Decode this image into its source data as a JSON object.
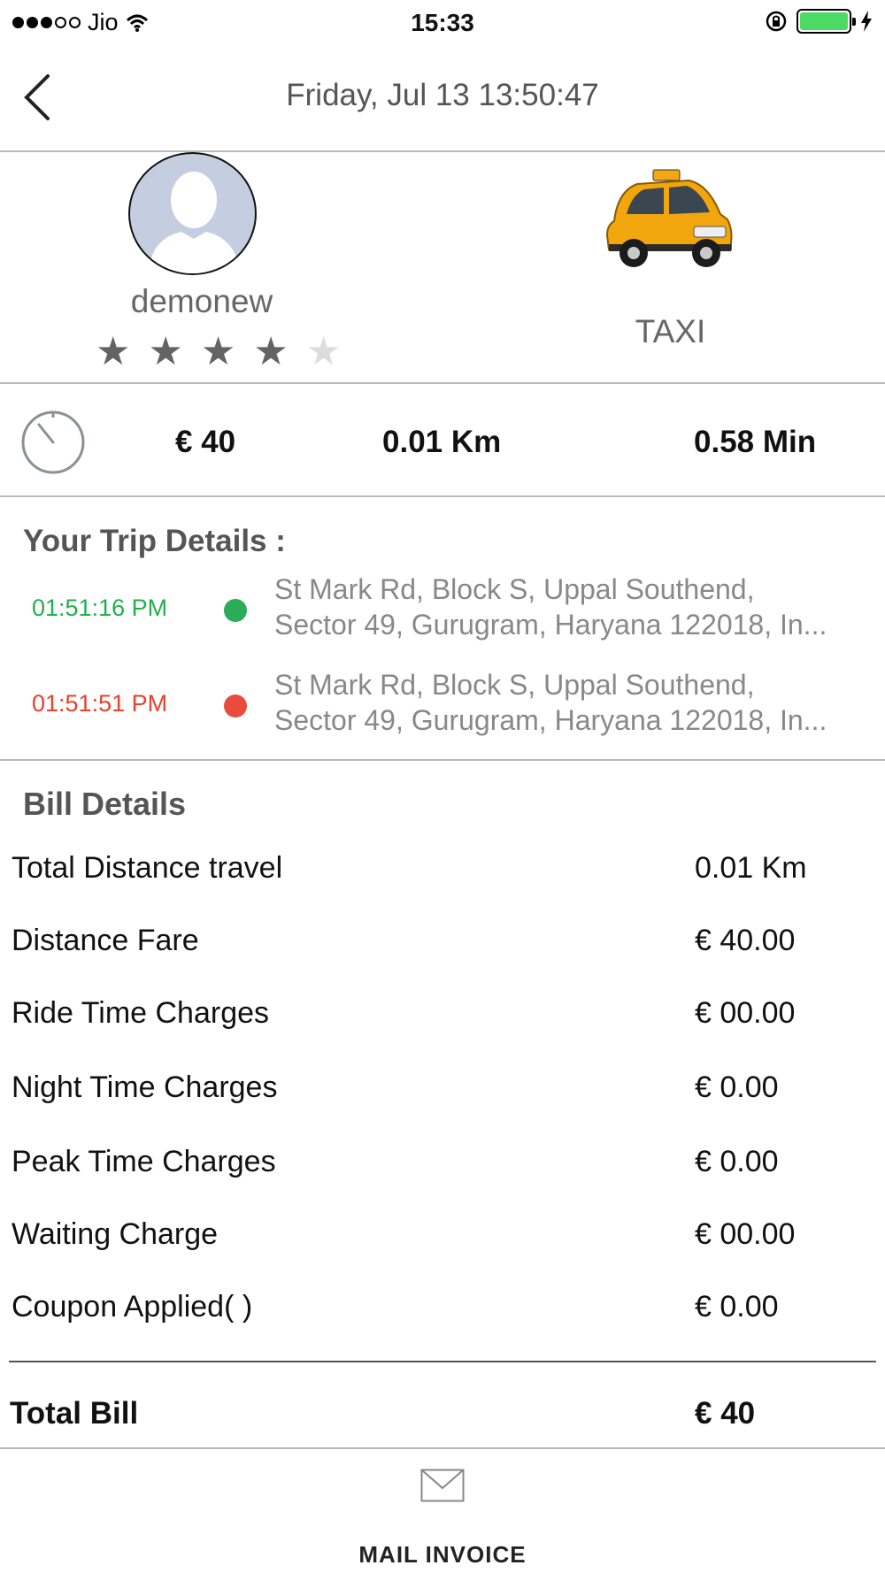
{
  "status_bar": {
    "carrier": "Jio",
    "time": "15:33",
    "signal_bars_filled": 3,
    "signal_bars_total": 5,
    "battery_level": 1.0
  },
  "nav": {
    "title": "Friday, Jul 13  13:50:47",
    "back_icon": "chevron-left-icon"
  },
  "driver": {
    "name": "demonew",
    "rating": 4,
    "rating_max": 5,
    "vehicle_type": "TAXI"
  },
  "summary": {
    "fare": "€ 40",
    "distance": "0.01 Km",
    "duration": "0.58 Min"
  },
  "trip": {
    "title": "Your Trip Details :",
    "pickup": {
      "time": "01:51:16 PM",
      "address_line1": "St Mark Rd, Block S, Uppal Southend,",
      "address_line2": "Sector 49, Gurugram, Haryana 122018, In..."
    },
    "drop": {
      "time": "01:51:51 PM",
      "address_line1": "St Mark Rd, Block S, Uppal Southend,",
      "address_line2": "Sector 49, Gurugram, Haryana 122018, In..."
    }
  },
  "bill": {
    "title": "Bill Details",
    "rows": [
      {
        "label": "Total Distance travel",
        "value": "0.01 Km"
      },
      {
        "label": "Distance Fare",
        "value": "€ 40.00"
      },
      {
        "label": "Ride Time Charges",
        "value": "€ 00.00"
      },
      {
        "label": "Night Time Charges",
        "value": "€ 0.00"
      },
      {
        "label": "Peak Time Charges",
        "value": "€ 0.00"
      },
      {
        "label": "Waiting Charge",
        "value": "€ 00.00"
      },
      {
        "label": "Coupon Applied(  )",
        "value": "€ 0.00"
      }
    ],
    "total_label": "Total Bill",
    "total_value": "€ 40"
  },
  "footer": {
    "mail_label": "MAIL INVOICE"
  },
  "colors": {
    "pickup": "#22b04b",
    "drop": "#e8412c",
    "divider": "#b9b9b9",
    "battery": "#4cd964"
  }
}
